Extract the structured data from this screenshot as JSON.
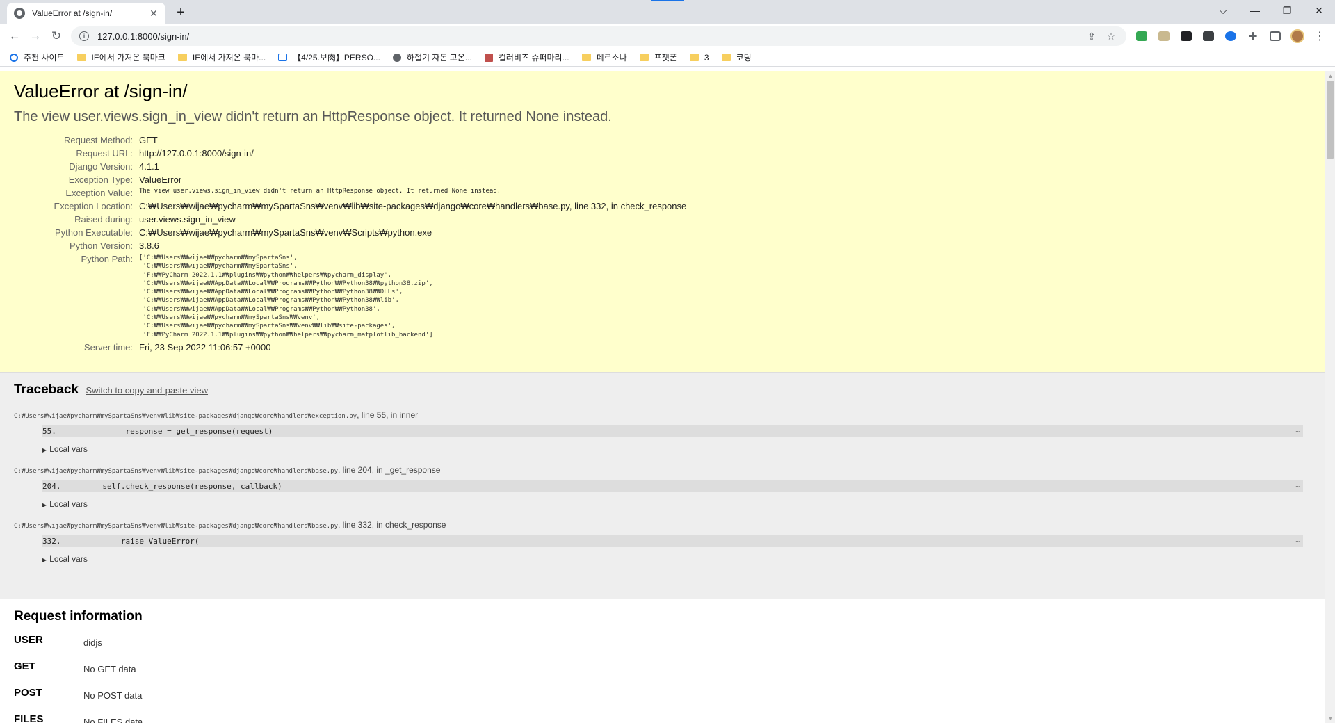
{
  "browser": {
    "tab_title": "ValueError at /sign-in/",
    "new_tab": "+",
    "url": "127.0.0.1:8000/sign-in/",
    "bookmarks": [
      {
        "label": "추천 사이트",
        "icon": "search-icon"
      },
      {
        "label": "IE에서 가져온 북마크",
        "icon": "folder-icon"
      },
      {
        "label": "IE에서 가져온 북마...",
        "icon": "folder-icon"
      },
      {
        "label": "【4/25.보肉】PERSO...",
        "icon": "calendar-icon"
      },
      {
        "label": "하절기 자돈 고온...",
        "icon": "globe-icon"
      },
      {
        "label": "컬러비즈 슈퍼마리...",
        "icon": "crm-icon"
      },
      {
        "label": "페르소나",
        "icon": "folder-icon"
      },
      {
        "label": "프젯폰",
        "icon": "folder-icon"
      },
      {
        "label": "3",
        "icon": "folder-icon"
      },
      {
        "label": "코딩",
        "icon": "folder-icon"
      }
    ]
  },
  "summary": {
    "title": "ValueError at /sign-in/",
    "exception_message": "The view user.views.sign_in_view didn't return an HttpResponse object. It returned None instead.",
    "labels": {
      "request_method": "Request Method:",
      "request_url": "Request URL:",
      "django_version": "Django Version:",
      "exception_type": "Exception Type:",
      "exception_value": "Exception Value:",
      "exception_location": "Exception Location:",
      "raised_during": "Raised during:",
      "python_executable": "Python Executable:",
      "python_version": "Python Version:",
      "python_path": "Python Path:",
      "server_time": "Server time:"
    },
    "values": {
      "request_method": "GET",
      "request_url": "http://127.0.0.1:8000/sign-in/",
      "django_version": "4.1.1",
      "exception_type": "ValueError",
      "exception_value": "The view user.views.sign_in_view didn't return an HttpResponse object. It returned None instead.",
      "exception_location": "C:₩Users₩wijae₩pycharm₩mySpartaSns₩venv₩lib₩site-packages₩django₩core₩handlers₩base.py, line 332, in check_response",
      "raised_during": "user.views.sign_in_view",
      "python_executable": "C:₩Users₩wijae₩pycharm₩mySpartaSns₩venv₩Scripts₩python.exe",
      "python_version": "3.8.6",
      "python_path": "['C:₩₩Users₩₩wijae₩₩pycharm₩₩mySpartaSns',\n 'C:₩₩Users₩₩wijae₩₩pycharm₩₩mySpartaSns',\n 'F:₩₩PyCharm 2022.1.1₩₩plugins₩₩python₩₩helpers₩₩pycharm_display',\n 'C:₩₩Users₩₩wijae₩₩AppData₩₩Local₩₩Programs₩₩Python₩₩Python38₩₩python38.zip',\n 'C:₩₩Users₩₩wijae₩₩AppData₩₩Local₩₩Programs₩₩Python₩₩Python38₩₩DLLs',\n 'C:₩₩Users₩₩wijae₩₩AppData₩₩Local₩₩Programs₩₩Python₩₩Python38₩₩lib',\n 'C:₩₩Users₩₩wijae₩₩AppData₩₩Local₩₩Programs₩₩Python₩₩Python38',\n 'C:₩₩Users₩₩wijae₩₩pycharm₩₩mySpartaSns₩₩venv',\n 'C:₩₩Users₩₩wijae₩₩pycharm₩₩mySpartaSns₩₩venv₩₩lib₩₩site-packages',\n 'F:₩₩PyCharm 2022.1.1₩₩plugins₩₩python₩₩helpers₩₩pycharm_matplotlib_backend']",
      "server_time": "Fri, 23 Sep 2022 11:06:57 +0000"
    }
  },
  "traceback": {
    "title": "Traceback",
    "switch_link": "Switch to copy-and-paste view",
    "local_vars_label": "Local vars",
    "frames": [
      {
        "path": "C:₩Users₩wijae₩pycharm₩mySpartaSns₩venv₩lib₩site-packages₩django₩core₩handlers₩exception.py",
        "suffix": ", line 55, in inner",
        "line_no": "55.",
        "code": "            response = get_response(request)"
      },
      {
        "path": "C:₩Users₩wijae₩pycharm₩mySpartaSns₩venv₩lib₩site-packages₩django₩core₩handlers₩base.py",
        "suffix": ", line 204, in _get_response",
        "line_no": "204.",
        "code": "       self.check_response(response, callback)"
      },
      {
        "path": "C:₩Users₩wijae₩pycharm₩mySpartaSns₩venv₩lib₩site-packages₩django₩core₩handlers₩base.py",
        "suffix": ", line 332, in check_response",
        "line_no": "332.",
        "code": "           raise ValueError("
      }
    ]
  },
  "request_info": {
    "title": "Request information",
    "rows": [
      {
        "key": "USER",
        "value": "didjs"
      },
      {
        "key": "GET",
        "value": "No GET data"
      },
      {
        "key": "POST",
        "value": "No POST data"
      },
      {
        "key": "FILES",
        "value": "No FILES data"
      }
    ]
  },
  "colors": {
    "summary_bg": "#ffffcc",
    "traceback_bg": "#eeeeee",
    "accent": "#1a73e8"
  }
}
